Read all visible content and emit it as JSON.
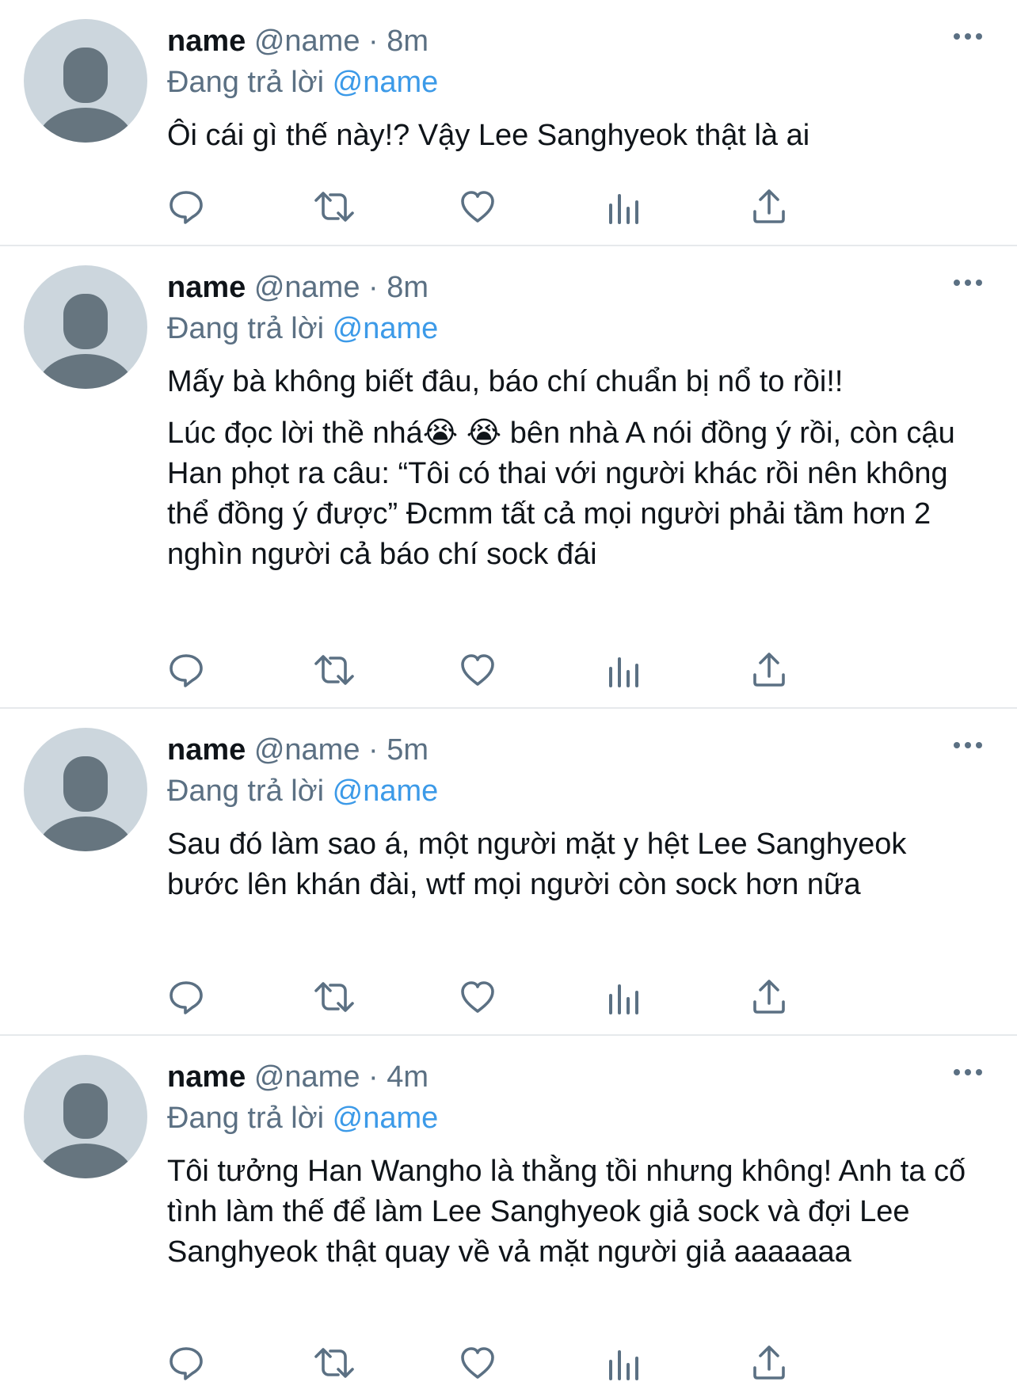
{
  "tweets": [
    {
      "display_name": "name",
      "handle": "@name",
      "separator": "·",
      "time": "8m",
      "reply_prefix": "Đang trả lời",
      "reply_to": "@name",
      "paragraphs": [
        "Ôi cái gì thế này!? Vậy Lee Sanghyeok thật là ai"
      ]
    },
    {
      "display_name": "name",
      "handle": "@name",
      "separator": "·",
      "time": "8m",
      "reply_prefix": "Đang trả lời",
      "reply_to": "@name",
      "paragraphs": [
        "Mấy bà không biết đâu, báo chí chuẩn bị nổ to rồi!!",
        "Lúc đọc lời thề nhá😭 😭 bên nhà A nói đồng ý rồi, còn cậu Han phọt ra câu: “Tôi có thai với người khác rồi nên không thể đồng ý được” Đcmm tất cả mọi người phải tầm hơn 2 nghìn người cả báo chí sock đái"
      ]
    },
    {
      "display_name": "name",
      "handle": "@name",
      "separator": "·",
      "time": "5m",
      "reply_prefix": "Đang trả lời",
      "reply_to": "@name",
      "paragraphs": [
        "Sau đó làm sao á, một người mặt y hệt Lee Sanghyeok bước lên khán đài, wtf mọi người còn sock hơn nữa"
      ]
    },
    {
      "display_name": "name",
      "handle": "@name",
      "separator": "·",
      "time": "4m",
      "reply_prefix": "Đang trả lời",
      "reply_to": "@name",
      "paragraphs": [
        "Tôi tưởng Han Wangho là thằng tồi nhưng không! Anh ta cố tình làm thế để làm Lee Sanghyeok giả sock và đợi Lee Sanghyeok thật quay về vả mặt người giả aaaaaaa"
      ]
    }
  ],
  "icons": {
    "actions": [
      "reply-icon",
      "retweet-icon",
      "like-icon",
      "views-icon",
      "share-icon"
    ],
    "more": "more-options-icon",
    "avatar": "default-avatar-icon"
  },
  "colors": {
    "text": "#0f1419",
    "secondary": "#5b7083",
    "mention": "#3c9ae8",
    "avatar_bg": "#ccd6dd",
    "avatar_fg": "#66757f",
    "divider": "#e6e9ec"
  }
}
